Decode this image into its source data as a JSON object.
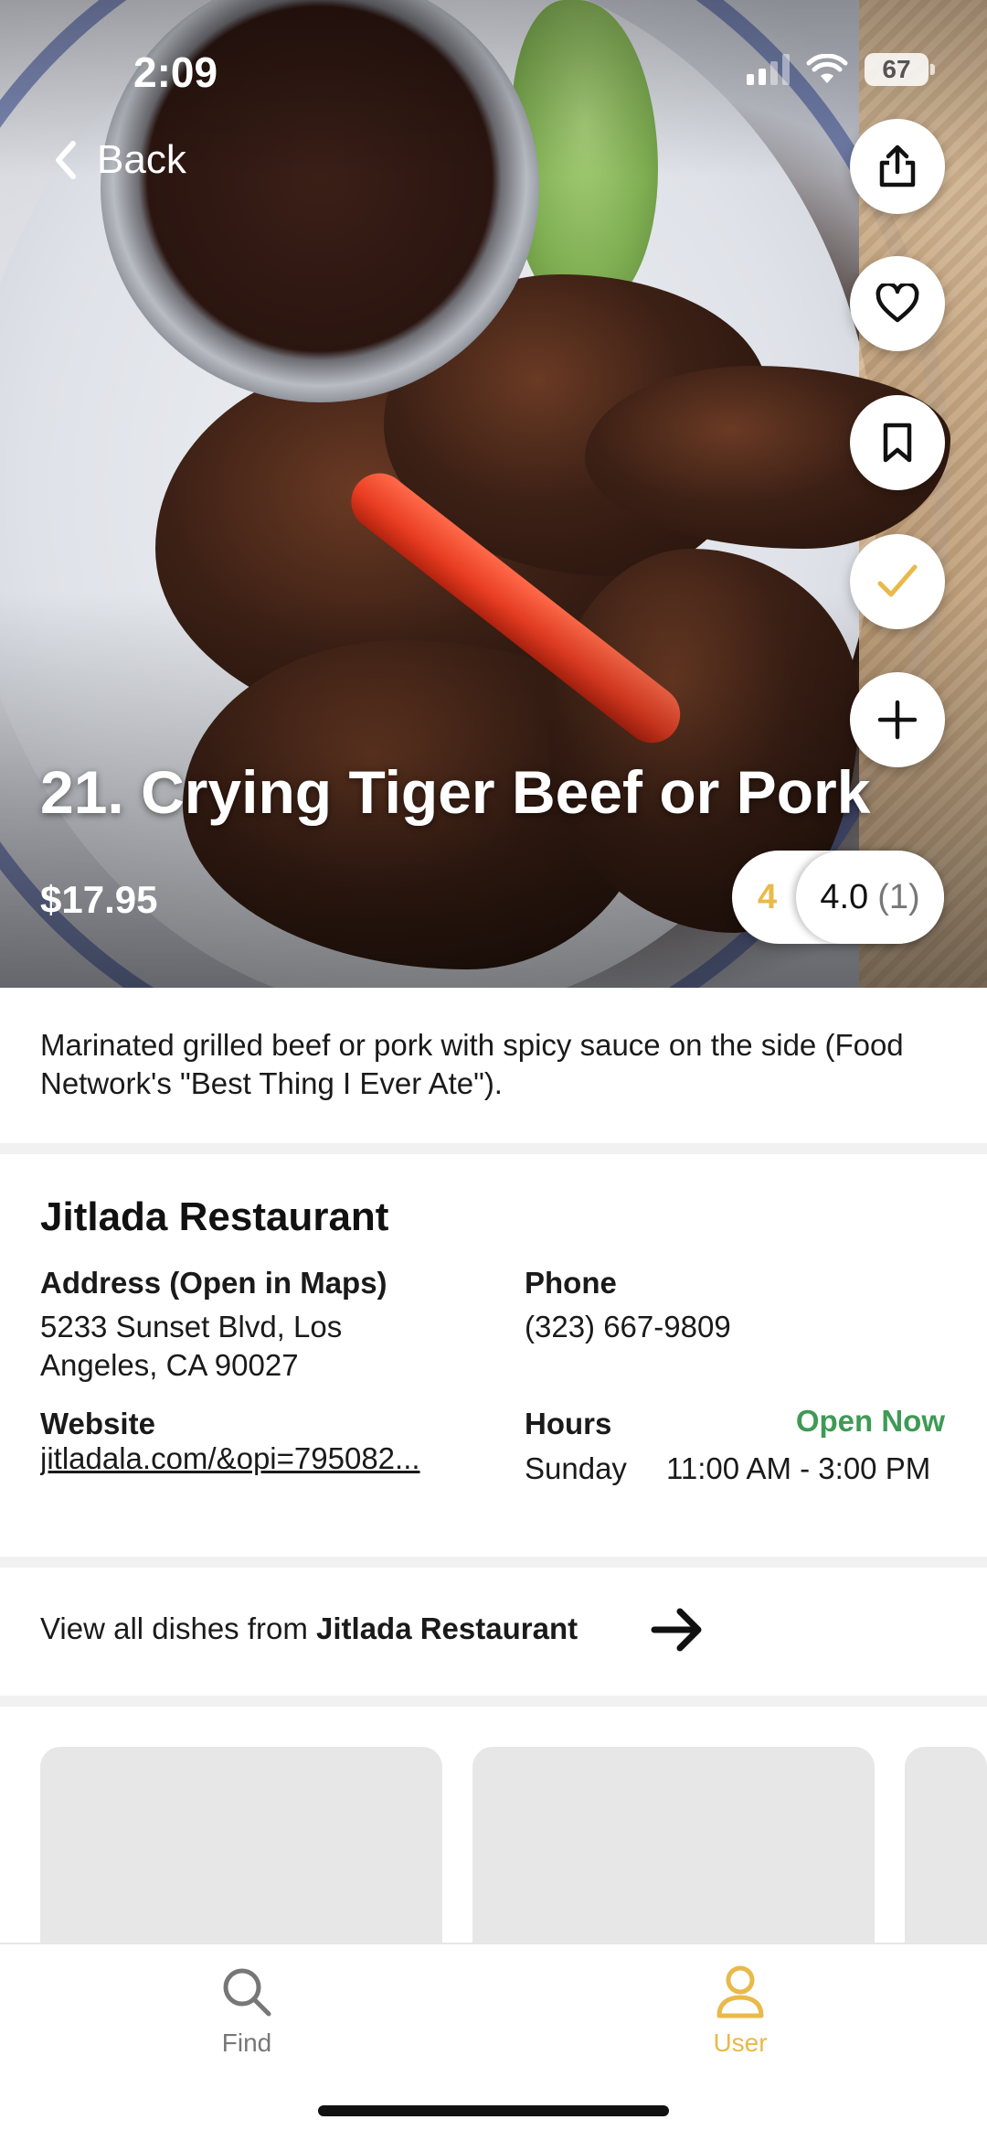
{
  "status_bar": {
    "time": "2:09",
    "battery": "67"
  },
  "nav": {
    "back_label": "Back"
  },
  "actions": {
    "share_icon": "share-icon",
    "favorite_icon": "heart-icon",
    "bookmark_icon": "bookmark-icon",
    "tried_icon": "checkmark-icon",
    "add_icon": "plus-icon",
    "tried_color": "#E9B949"
  },
  "dish": {
    "title": "21. Crying Tiger Beef or Pork",
    "price": "$17.95",
    "description": "Marinated grilled beef or pork with spicy sauce on the side (Food Network's \"Best Thing I Ever Ate\")."
  },
  "rating": {
    "my_rating": "4",
    "average": "4.0",
    "count": "(1)",
    "my_rating_color": "#E9B949"
  },
  "restaurant": {
    "name": "Jitlada Restaurant",
    "address_label": "Address (Open in Maps)",
    "address": "5233 Sunset Blvd, Los Angeles, CA 90027",
    "phone_label": "Phone",
    "phone": "(323) 667-9809",
    "website_label": "Website",
    "website": "jitladala.com/&opi=795082...",
    "hours_label": "Hours",
    "open_status": "Open Now",
    "open_status_color": "#3F9A55",
    "hours_day": "Sunday",
    "hours_time": "11:00 AM - 3:00 PM"
  },
  "view_all": {
    "prefix": "View all dishes from ",
    "restaurant": "Jitlada Restaurant"
  },
  "tabbar": {
    "tabs": [
      {
        "label": "Find",
        "icon": "search-icon",
        "active": false
      },
      {
        "label": "User",
        "icon": "user-icon",
        "active": true
      }
    ],
    "active_color": "#E9B949",
    "inactive_color": "#777777"
  }
}
